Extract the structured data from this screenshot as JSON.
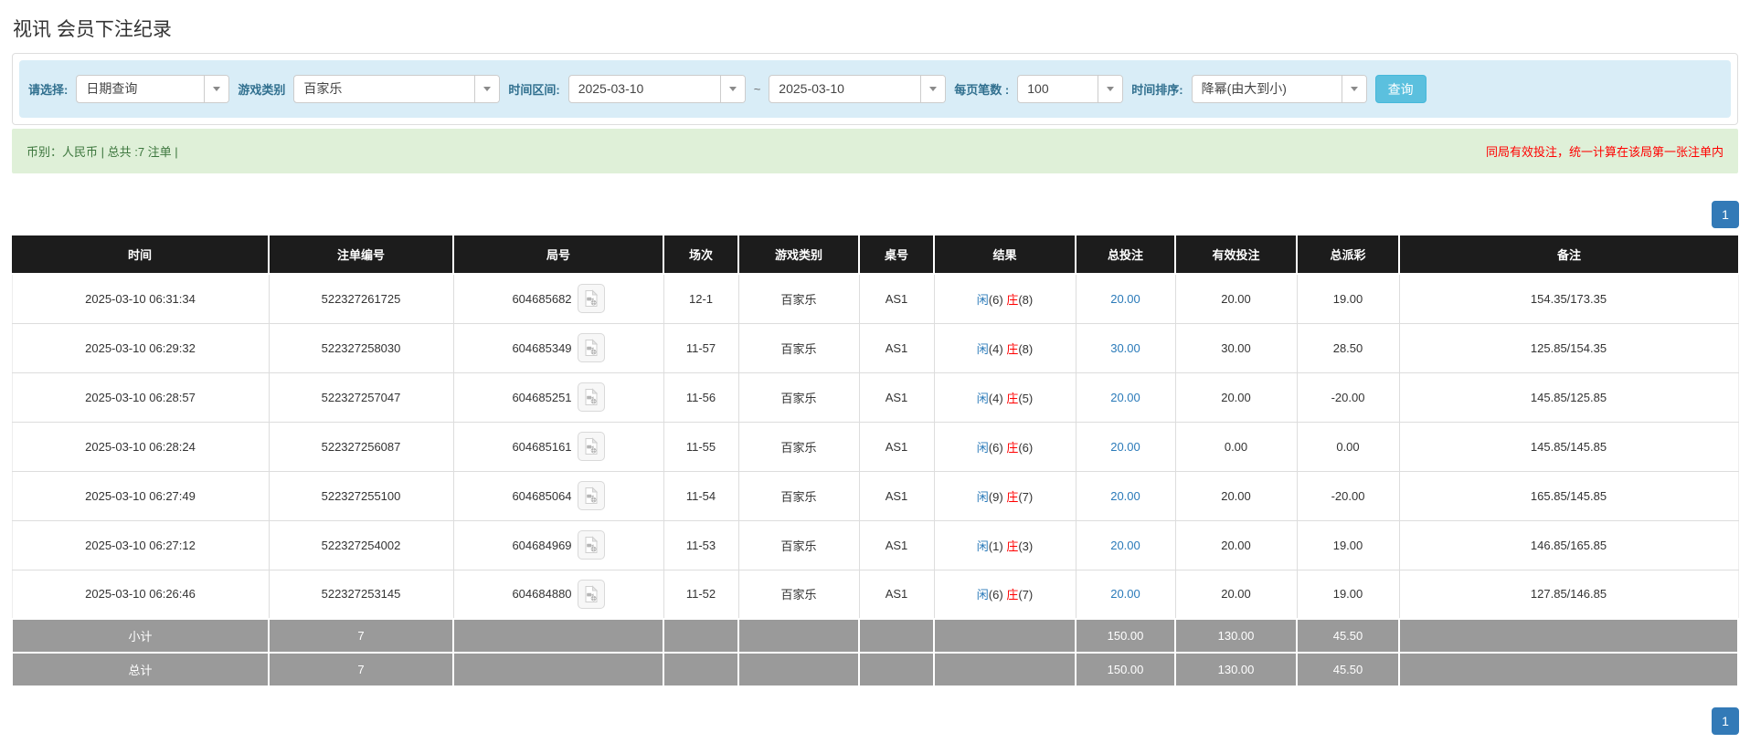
{
  "page": {
    "title": "视讯 会员下注纪录"
  },
  "filters": {
    "select_label": "请选择:",
    "select_value": "日期查询",
    "game_label": "游戏类别",
    "game_value": "百家乐",
    "range_label": "时间区间:",
    "range_from": "2025-03-10",
    "range_tilde": "~",
    "range_to": "2025-03-10",
    "per_page_label": "每页笔数 :",
    "per_page_value": "100",
    "sort_label": "时间排序:",
    "sort_value": "降幂(由大到小)",
    "search_button": "查询"
  },
  "summary": {
    "left_text": "币别：人民币 | 总共 :7 注单 |",
    "right_text": "同局有效投注，统一计算在该局第一张注单内"
  },
  "pagination": {
    "page": "1"
  },
  "colors": {
    "accent_blue": "#337ab7",
    "search_button": "#5bc0de",
    "link_blue": "#2a7ab9",
    "negative_red": "#ff0000",
    "summary_green": "#3c763d",
    "header_black": "#1c1c1c",
    "footer_gray": "#9a9a9a",
    "filter_bg": "#d9edf7",
    "alert_bg": "#dff0d8"
  },
  "table": {
    "headers": [
      "时间",
      "注单编号",
      "局号",
      "场次",
      "游戏类别",
      "桌号",
      "结果",
      "总投注",
      "有效投注",
      "总派彩",
      "备注"
    ],
    "rows": [
      {
        "time": "2025-03-10 06:31:34",
        "bet_id": "522327261725",
        "round_id": "604685682",
        "session": "12-1",
        "game": "百家乐",
        "table_no": "AS1",
        "result_player": "闲",
        "result_player_num": "(6)",
        "result_banker": "庄",
        "result_banker_num": "(8)",
        "total_bet": "20.00",
        "valid_bet": "20.00",
        "payout": "19.00",
        "remark": "154.35/173.35"
      },
      {
        "time": "2025-03-10 06:29:32",
        "bet_id": "522327258030",
        "round_id": "604685349",
        "session": "11-57",
        "game": "百家乐",
        "table_no": "AS1",
        "result_player": "闲",
        "result_player_num": "(4)",
        "result_banker": "庄",
        "result_banker_num": "(8)",
        "total_bet": "30.00",
        "valid_bet": "30.00",
        "payout": "28.50",
        "remark": "125.85/154.35"
      },
      {
        "time": "2025-03-10 06:28:57",
        "bet_id": "522327257047",
        "round_id": "604685251",
        "session": "11-56",
        "game": "百家乐",
        "table_no": "AS1",
        "result_player": "闲",
        "result_player_num": "(4)",
        "result_banker": "庄",
        "result_banker_num": "(5)",
        "total_bet": "20.00",
        "valid_bet": "20.00",
        "payout": "-20.00",
        "remark": "145.85/125.85"
      },
      {
        "time": "2025-03-10 06:28:24",
        "bet_id": "522327256087",
        "round_id": "604685161",
        "session": "11-55",
        "game": "百家乐",
        "table_no": "AS1",
        "result_player": "闲",
        "result_player_num": "(6)",
        "result_banker": "庄",
        "result_banker_num": "(6)",
        "total_bet": "20.00",
        "valid_bet": "0.00",
        "payout": "0.00",
        "remark": "145.85/145.85"
      },
      {
        "time": "2025-03-10 06:27:49",
        "bet_id": "522327255100",
        "round_id": "604685064",
        "session": "11-54",
        "game": "百家乐",
        "table_no": "AS1",
        "result_player": "闲",
        "result_player_num": "(9)",
        "result_banker": "庄",
        "result_banker_num": "(7)",
        "total_bet": "20.00",
        "valid_bet": "20.00",
        "payout": "-20.00",
        "remark": "165.85/145.85"
      },
      {
        "time": "2025-03-10 06:27:12",
        "bet_id": "522327254002",
        "round_id": "604684969",
        "session": "11-53",
        "game": "百家乐",
        "table_no": "AS1",
        "result_player": "闲",
        "result_player_num": "(1)",
        "result_banker": "庄",
        "result_banker_num": "(3)",
        "total_bet": "20.00",
        "valid_bet": "20.00",
        "payout": "19.00",
        "remark": "146.85/165.85"
      },
      {
        "time": "2025-03-10 06:26:46",
        "bet_id": "522327253145",
        "round_id": "604684880",
        "session": "11-52",
        "game": "百家乐",
        "table_no": "AS1",
        "result_player": "闲",
        "result_player_num": "(6)",
        "result_banker": "庄",
        "result_banker_num": "(7)",
        "total_bet": "20.00",
        "valid_bet": "20.00",
        "payout": "19.00",
        "remark": "127.85/146.85"
      }
    ],
    "subtotal": {
      "label": "小计",
      "count": "7",
      "total_bet": "150.00",
      "valid_bet": "130.00",
      "payout": "45.50"
    },
    "total": {
      "label": "总计",
      "count": "7",
      "total_bet": "150.00",
      "valid_bet": "130.00",
      "payout": "45.50"
    }
  }
}
